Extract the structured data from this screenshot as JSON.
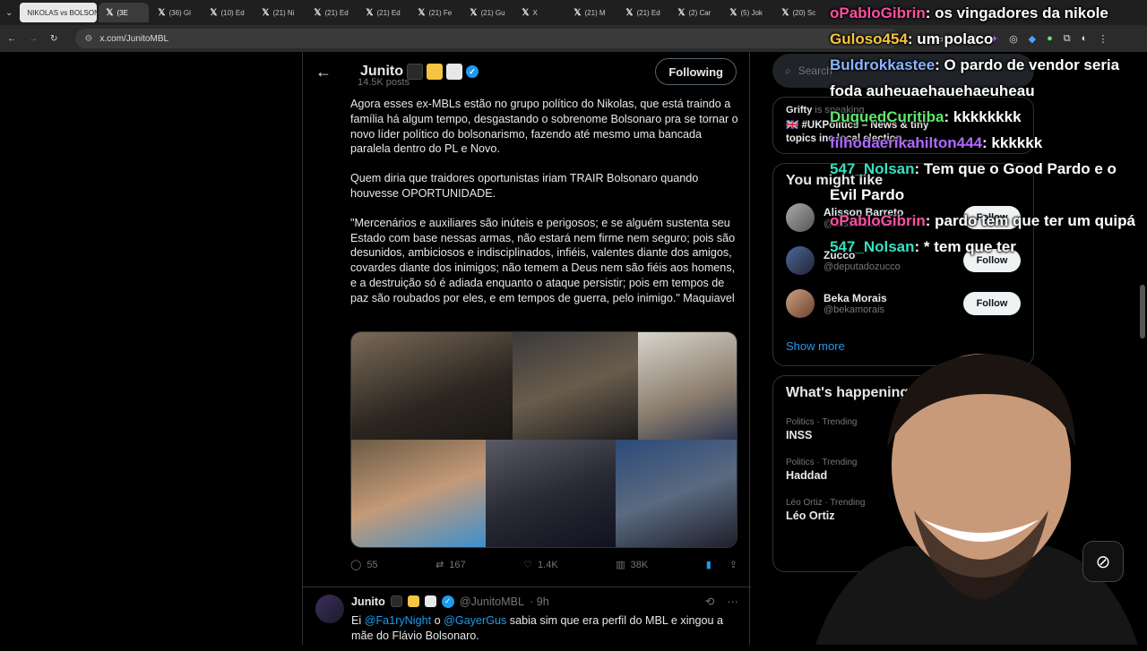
{
  "browser": {
    "tabs": [
      {
        "label": "NIKOLAS vs BOLSONA",
        "group": true
      },
      {
        "label": "(3E",
        "active": true
      },
      {
        "label": "(36) Gl"
      },
      {
        "label": "(10) Ed"
      },
      {
        "label": "(21) Ni"
      },
      {
        "label": "(21) Ed"
      },
      {
        "label": "(21) Ed"
      },
      {
        "label": "(21) Fe"
      },
      {
        "label": "(21) Gu"
      },
      {
        "label": "X"
      },
      {
        "label": "(21) M"
      },
      {
        "label": "(21) Ed"
      },
      {
        "label": "(2) Car"
      },
      {
        "label": "(5) Jok"
      },
      {
        "label": "(20) Sc"
      }
    ],
    "url": "x.com/JunitoMBL"
  },
  "profile_header": {
    "name": "Junito",
    "posts": "14.5K posts",
    "following_label": "Following",
    "emoji_colors": [
      "#2a2a2a",
      "#f5c542",
      "#e8e8e8"
    ]
  },
  "tweet": {
    "paragraphs": [
      "Agora esses ex-MBLs estão no grupo político do Nikolas, que está traindo a família há algum tempo, desgastando o sobrenome Bolsonaro pra se tornar o novo líder político do bolsonarismo, fazendo até mesmo uma bancada paralela dentro do PL e Novo.",
      "Quem diria que traidores oportunistas iriam TRAIR Bolsonaro quando houvesse OPORTUNIDADE.",
      "\"Mercenários e auxiliares são inúteis e perigosos; e se alguém sustenta seu Estado com base nessas armas, não estará nem firme nem seguro; pois são desunidos, ambiciosos e indisciplinados, infiéis, valentes diante dos amigos, covardes diante dos inimigos; não temem a Deus nem são fiéis aos homens, e a destruição só é adiada enquanto o ataque persistir; pois em tempos de paz são roubados por eles, e em tempos de guerra, pelo inimigo.\" Maquiavel"
    ],
    "replies": "55",
    "reposts": "167",
    "likes": "1.4K",
    "views": "38K"
  },
  "reply": {
    "name": "Junito",
    "handle": "@JunitoMBL",
    "time": "· 9h",
    "text_prefix": "Ei",
    "mention1": "@Fa1ryNight",
    "text_mid": "o",
    "mention2": "@GayerGus",
    "text_rest": "sabia sim que era perfil do MBL e xingou a mãe do Flávio Bolsonaro."
  },
  "sidebar": {
    "search_placeholder": "Search",
    "spaces": {
      "host": "Grifty",
      "status": "is speaking",
      "topic": "🇬🇧 #UKPolitics – News & tiny topics inc local election..."
    },
    "who_to_follow_title": "You might like",
    "suggestions": [
      {
        "name": "Alisson Barreto",
        "handle": "@alissonbarreto",
        "button": "Follow"
      },
      {
        "name": "Zucco",
        "handle": "@deputadozucco",
        "button": "Follow"
      },
      {
        "name": "Beka Morais",
        "handle": "@bekamorais",
        "button": "Follow"
      }
    ],
    "show_more": "Show more",
    "trends_title": "What's happening",
    "trends": [
      {
        "meta": "Politics · Trending",
        "name": "INSS"
      },
      {
        "meta": "Politics · Trending",
        "name": "Haddad"
      },
      {
        "meta": "Léo Ortiz · Trending",
        "name": "Léo Ortiz"
      }
    ]
  },
  "stream_chat": [
    {
      "user": "oPabloGibrin",
      "color": "#ff4fa3",
      "msg": ": os vingadores da nikole"
    },
    {
      "user": "Guloso454",
      "color": "#f5c542",
      "msg": ": um polaco"
    },
    {
      "user": "Buldrokkastee",
      "color": "#8ab4ff",
      "msg": ": O pardo de vendor seria foda auheuaehauehaeuheau"
    },
    {
      "user": "DuquedCuritiba",
      "color": "#5ee86a",
      "msg": ": kkkkkkkk"
    },
    {
      "user": "filhodaerikahilton444",
      "color": "#b068ff",
      "msg": ": kkkkkk"
    },
    {
      "user": "547_Nolsan",
      "color": "#38e0c0",
      "msg": ": Tem que o Good Pardo e o Evil Pardo"
    },
    {
      "user": "oPabloGibrin",
      "color": "#ff4fa3",
      "msg": ": pardo tem que ter um quipá"
    },
    {
      "user": "547_Nolsan",
      "color": "#38e0c0",
      "msg": ": * tem que ter"
    }
  ]
}
